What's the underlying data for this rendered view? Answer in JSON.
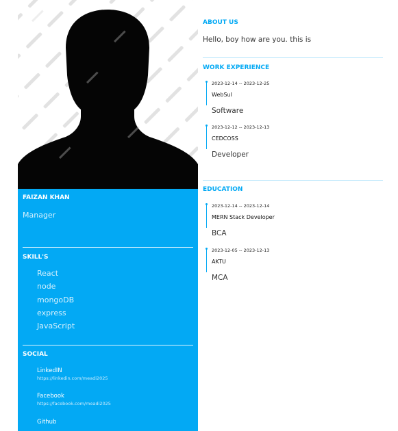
{
  "profile": {
    "name": "FAIZAN KHAN",
    "role": "Manager"
  },
  "skills": {
    "title": "SKILL'S",
    "items": [
      "React",
      "node",
      "mongoDB",
      "express",
      "JavaScript"
    ]
  },
  "social": {
    "title": "SOCIAL",
    "items": [
      {
        "name": "LinkedIN",
        "url": "https://linkedin.com/meadi2025"
      },
      {
        "name": "Facebook",
        "url": "https://facebook.com/meadi2025"
      },
      {
        "name": "Github",
        "url": ""
      }
    ]
  },
  "about": {
    "title": "ABOUT US",
    "text": "Hello, boy how are you. this is"
  },
  "work": {
    "title": "WORK EXPERIENCE",
    "items": [
      {
        "dates": "2023-12-14 -- 2023-12-25",
        "org": "WebSul",
        "title": "Software"
      },
      {
        "dates": "2023-12-12 -- 2023-12-13",
        "org": "CEDCOSS",
        "title": "Developer"
      }
    ]
  },
  "education": {
    "title": "EDUCATION",
    "items": [
      {
        "dates": "2023-12-14 -- 2023-12-14",
        "org": "MERN Stack Developer",
        "title": "BCA"
      },
      {
        "dates": "2023-12-05 -- 2023-12-13",
        "org": "AKTU",
        "title": "MCA"
      }
    ]
  },
  "colors": {
    "accent": "#03a9f4",
    "sidebar": "#03a9f4"
  },
  "photo": {
    "watermark": "Adobe Stock"
  }
}
